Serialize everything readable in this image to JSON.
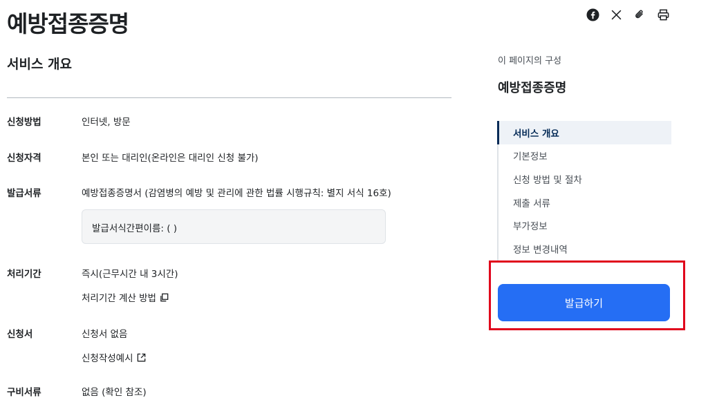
{
  "page": {
    "title": "예방접종증명"
  },
  "share": {
    "icons": [
      "facebook-icon",
      "x-twitter-icon",
      "attach-link-icon",
      "print-icon"
    ]
  },
  "overview": {
    "section_title": "서비스 개요",
    "rows": {
      "method": {
        "label": "신청방법",
        "value": "인터넷, 방문"
      },
      "eligibility": {
        "label": "신청자격",
        "value": "본인 또는 대리인(온라인은 대리인 신청 불가)"
      },
      "document": {
        "label": "발급서류",
        "value": "예방접종증명서 (감염병의 예방 및 관리에 관한 법률 시행규칙: 별지 서식 16호)",
        "box_text": "발급서식간편이름: ( )"
      },
      "period": {
        "label": "처리기간",
        "value": "즉시(근무시간 내 3시간)",
        "link": "처리기간 계산 방법"
      },
      "form": {
        "label": "신청서",
        "value": "신청서 없음",
        "link": "신청작성예시"
      },
      "fee": {
        "label": "구비서류",
        "value": "없음 (확인 참조)"
      }
    }
  },
  "toc": {
    "label": "이 페이지의 구성",
    "title": "예방접종증명",
    "items": [
      "서비스 개요",
      "기본정보",
      "신청 방법 및 절차",
      "제출 서류",
      "부가정보",
      "정보 변경내역"
    ],
    "active_index": 0
  },
  "actions": {
    "issue_label": "발급하기"
  },
  "colors": {
    "primary": "#256ef4",
    "highlight": "#e0001b",
    "toc_active": "#052b57"
  }
}
